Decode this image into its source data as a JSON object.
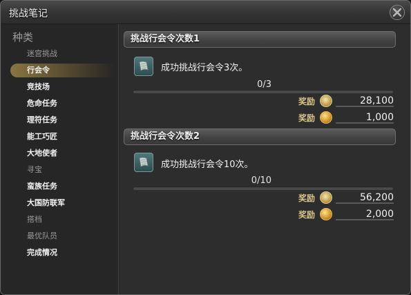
{
  "window": {
    "title": "挑战笔记"
  },
  "sidebar": {
    "heading": "种类",
    "items": [
      {
        "label": "迷宫挑战",
        "state": "dim"
      },
      {
        "label": "行会令",
        "state": "selected"
      },
      {
        "label": "竞技场",
        "state": "normal"
      },
      {
        "label": "危命任务",
        "state": "normal"
      },
      {
        "label": "理符任务",
        "state": "normal"
      },
      {
        "label": "能工巧匠",
        "state": "normal"
      },
      {
        "label": "大地使者",
        "state": "normal"
      },
      {
        "label": "寻宝",
        "state": "dim"
      },
      {
        "label": "蛮族任务",
        "state": "normal"
      },
      {
        "label": "大国防联军",
        "state": "normal"
      },
      {
        "label": "搭档",
        "state": "dim"
      },
      {
        "label": "最优队员",
        "state": "dim"
      },
      {
        "label": "完成情况",
        "state": "normal"
      }
    ]
  },
  "challenges": [
    {
      "title": "挑战行会令次数1",
      "description": "成功挑战行会令3次。",
      "progress_text": "0/3",
      "progress_fraction": 0,
      "rewards": [
        {
          "label": "奖励",
          "icon": "seals-icon",
          "value": "28,100"
        },
        {
          "label": "奖励",
          "icon": "gil-icon",
          "value": "1,000"
        }
      ]
    },
    {
      "title": "挑战行会令次数2",
      "description": "成功挑战行会令10次。",
      "progress_text": "0/10",
      "progress_fraction": 0,
      "rewards": [
        {
          "label": "奖励",
          "icon": "seals-icon",
          "value": "56,200"
        },
        {
          "label": "奖励",
          "icon": "gil-icon",
          "value": "2,000"
        }
      ]
    }
  ]
}
